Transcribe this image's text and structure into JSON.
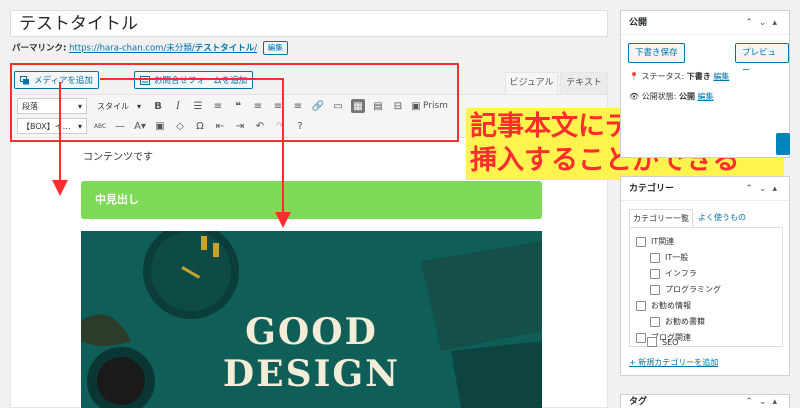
{
  "title": "テストタイトル",
  "permalink": {
    "label": "パーマリンク:",
    "url": "https://hara-chan.com/未分類/",
    "slug": "テストタイトル",
    "tail": "/",
    "edit": "編集"
  },
  "editor": {
    "media_button": "メディアを追加",
    "form_button": "お問合せフォームを追加",
    "tab_visual": "ビジュアル",
    "tab_text": "テキスト",
    "format_select": "段落",
    "style_select": "スタイル",
    "box_select": "【BOX】イ…",
    "prism": "Prism",
    "content_text": "コンテンツです",
    "heading": "中見出し",
    "image_text": [
      "GOOD",
      "DESIGN"
    ]
  },
  "annotation": {
    "lines": [
      "記事本文にデザインを",
      "挿入することができる"
    ],
    "color": "#ff2d2d",
    "background": "#fff34d"
  },
  "publish": {
    "title": "公開",
    "draft": "下書き保存",
    "preview": "プレビュー",
    "status_label": "ステータス:",
    "status_value": "下書き",
    "status_edit": "編集",
    "visibility_label": "公開状態:",
    "visibility_value": "公開",
    "visibility_edit": "編集"
  },
  "category": {
    "title": "カテゴリー",
    "tab_all": "カテゴリー一覧",
    "tab_popular": "よく使うもの",
    "items": [
      "IT関連",
      "IT一般",
      "インフラ",
      "プログラミング",
      "お勧め情報",
      "お勧め書籍",
      "ブログ関連",
      "SEO"
    ],
    "add_new": "+ 新規カテゴリーを追加"
  },
  "tag": {
    "title": "タグ"
  }
}
